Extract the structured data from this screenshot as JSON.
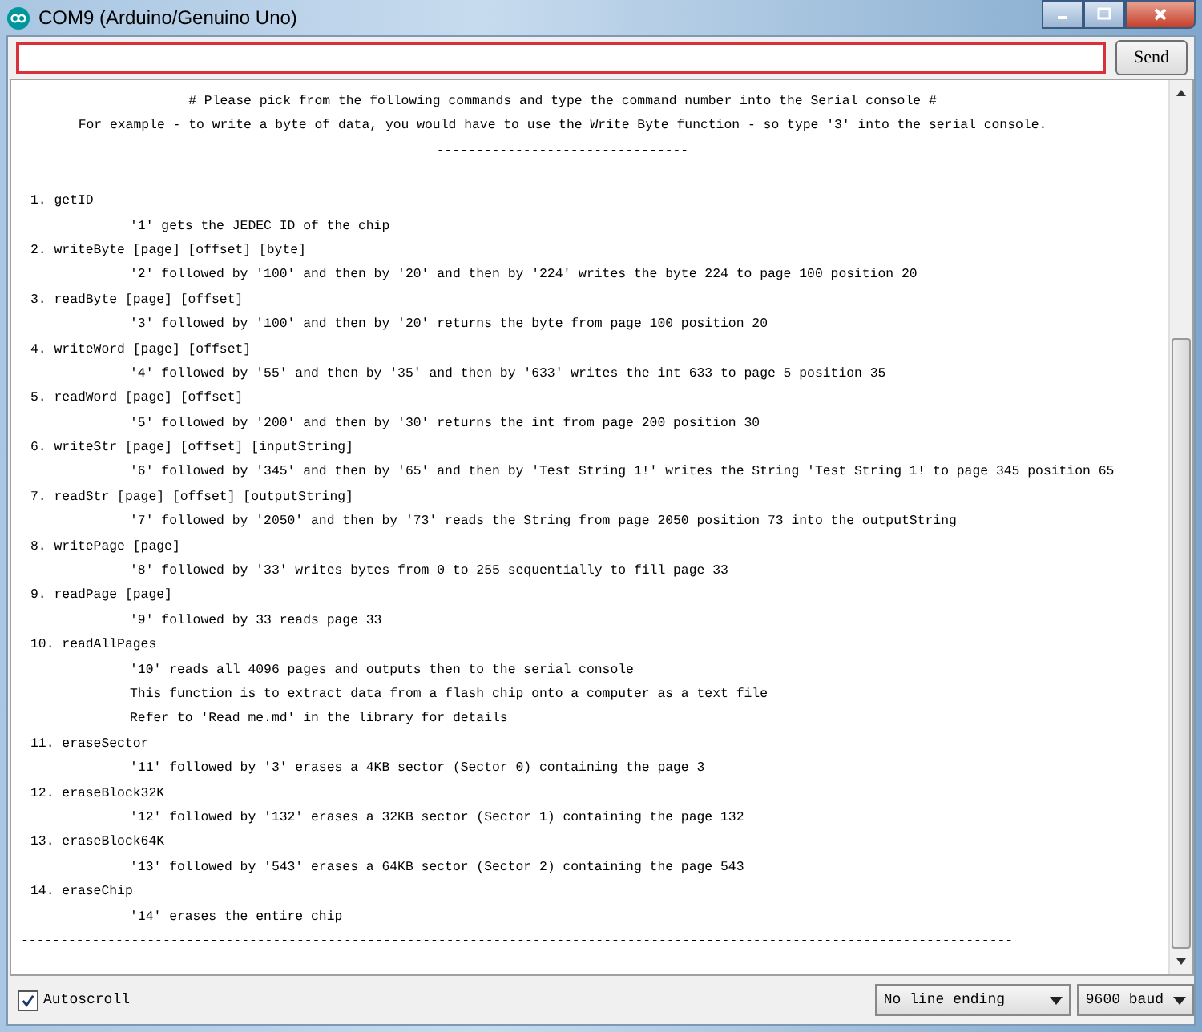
{
  "window": {
    "title": "COM9 (Arduino/Genuino Uno)"
  },
  "input": {
    "focused": true
  },
  "send_button": "Send",
  "console": {
    "intro": [
      "# Please pick from the following commands and type the command number into the Serial console #",
      "For example - to write a byte of data, you would have to use the Write Byte function - so type '3' into the serial console.",
      "--------------------------------"
    ],
    "commands": [
      {
        "label": "1. getID",
        "details": [
          "'1' gets the JEDEC ID of the chip"
        ]
      },
      {
        "label": "2. writeByte [page] [offset] [byte]",
        "details": [
          "'2' followed by '100' and then by '20' and then by '224' writes the byte 224 to page 100 position 20"
        ]
      },
      {
        "label": "3. readByte [page] [offset]",
        "details": [
          "'3' followed by '100' and then by '20' returns the byte from page 100 position 20"
        ]
      },
      {
        "label": "4. writeWord [page] [offset]",
        "details": [
          "'4' followed by '55' and then by '35' and then by '633' writes the int 633 to page 5 position 35"
        ]
      },
      {
        "label": "5. readWord [page] [offset]",
        "details": [
          "'5' followed by '200' and then by '30' returns the int from page 200 position 30"
        ]
      },
      {
        "label": "6. writeStr [page] [offset] [inputString]",
        "details": [
          "'6' followed by '345' and then by '65' and then by 'Test String 1!' writes the String 'Test String 1! to page 345 position 65"
        ]
      },
      {
        "label": "7. readStr [page] [offset] [outputString]",
        "details": [
          "'7' followed by '2050' and then by '73' reads the String from page 2050 position 73 into the outputString"
        ]
      },
      {
        "label": "8. writePage [page]",
        "details": [
          "'8' followed by '33' writes bytes from 0 to 255 sequentially to fill page 33"
        ]
      },
      {
        "label": "9. readPage [page]",
        "details": [
          "'9' followed by 33 reads page 33"
        ]
      },
      {
        "label": "10. readAllPages",
        "details": [
          "'10' reads all 4096 pages and outputs then to the serial console",
          "This function is to extract data from a flash chip onto a computer as a text file",
          "Refer to 'Read me.md' in the library for details"
        ]
      },
      {
        "label": "11. eraseSector",
        "details": [
          "'11' followed by '3' erases a 4KB sector (Sector 0) containing the page 3"
        ]
      },
      {
        "label": "12. eraseBlock32K",
        "details": [
          "'12' followed by '132' erases a 32KB sector (Sector 1) containing the page 132"
        ]
      },
      {
        "label": "13. eraseBlock64K",
        "details": [
          "'13' followed by '543' erases a 64KB sector (Sector 2) containing the page 543"
        ]
      },
      {
        "label": "14. eraseChip",
        "details": [
          "'14' erases the entire chip"
        ]
      }
    ],
    "footer": "------------------------------------------------------------------------------------------------------------------------------"
  },
  "autoscroll": {
    "label": "Autoscroll",
    "checked": true
  },
  "dropdowns": [
    {
      "value": "No line ending"
    },
    {
      "value": "9600 baud"
    }
  ]
}
